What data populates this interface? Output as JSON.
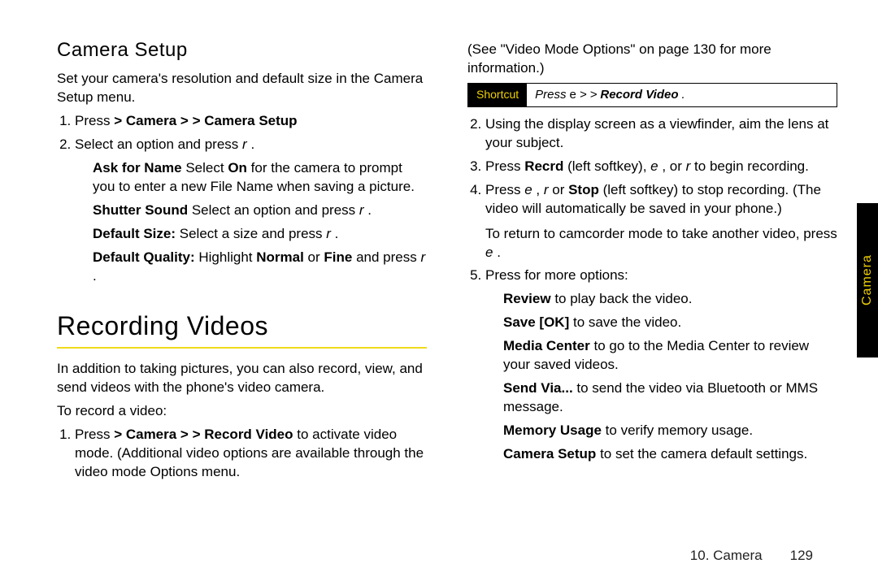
{
  "left": {
    "cameraSetup": {
      "heading": "Camera Setup",
      "intro": "Set your camera's resolution and default size in the Camera Setup menu.",
      "step1_a": "Press ",
      "step1_b": "> Camera > ",
      "step1_c": "> Camera Setup",
      "step2": "Select an option and press ",
      "step2_key": "r",
      "step2_end": ".",
      "sub": {
        "askName_label": "Ask for Name",
        "askName_text_a": " Select ",
        "askName_on": "On",
        "askName_text_b": " for the camera to prompt you to enter a new File Name when saving a picture.",
        "shutter_label": "Shutter Sound",
        "shutter_text": " Select an option and press ",
        "shutter_key": "r",
        "shutter_end": ".",
        "defSize_label": "Default Size:",
        "defSize_text": " Select a size and press ",
        "defSize_key": "r",
        "defSize_end": ".",
        "defQual_label": "Default Quality:",
        "defQual_text_a": " Highlight ",
        "defQual_normal": "Normal",
        "defQual_or": " or ",
        "defQual_fine": "Fine",
        "defQual_text_b": " and press ",
        "defQual_key": "r",
        "defQual_end": "."
      }
    },
    "recordingVideos": {
      "heading": "Recording Videos",
      "intro": "In addition to taking pictures, you can also record, view, and send videos with the phone's video camera.",
      "toRecord": "To record a video:",
      "step1_a": "Press ",
      "step1_b": "> Camera > ",
      "step1_c": "> Record Video",
      "step1_d": " to activate video mode. (Additional video options are available through the video mode Options menu."
    }
  },
  "right": {
    "see_text": "(See \"Video Mode Options\" on page 130 for more information.)",
    "shortcut": {
      "label": "Shortcut",
      "press": "Press ",
      "key1": "e",
      "sep1": " > ",
      "sep2": " > ",
      "record": "Record Video",
      "end": "."
    },
    "step2": "Using the display screen as a viewfinder, aim the lens at your subject.",
    "step3_a": "Press ",
    "step3_recrd": "Recrd",
    "step3_b": " (left softkey), ",
    "step3_key1": "e",
    "step3_c": ", or ",
    "step3_key2": "r",
    "step3_d": " to begin recording.",
    "step4_a": "Press ",
    "step4_key1": "e",
    "step4_b": ", ",
    "step4_key2": "r",
    "step4_c": " or ",
    "step4_stop": "Stop",
    "step4_d": " (left softkey) to stop recording. (The video will automatically be saved in your phone.)",
    "step4_return_a": "To return to camcorder mode to take another video, press ",
    "step4_return_key": "e",
    "step4_return_b": ".",
    "step5_a": "Press ",
    "step5_b": " for more options:",
    "sub": {
      "review_label": "Review",
      "review_text": " to play back the video.",
      "save_label": "Save [OK]",
      "save_text": " to save the video.",
      "media_label": "Media Center",
      "media_text": " to go to the Media Center to review your saved videos.",
      "send_label": "Send Via...",
      "send_text": " to send the video via Bluetooth or MMS message.",
      "mem_label": "Memory Usage",
      "mem_text": " to verify memory usage.",
      "cam_label": "Camera Setup",
      "cam_text": " to set the camera default settings."
    }
  },
  "footer": {
    "chapter": "10. Camera",
    "page": "129"
  },
  "sideTab": "Camera"
}
